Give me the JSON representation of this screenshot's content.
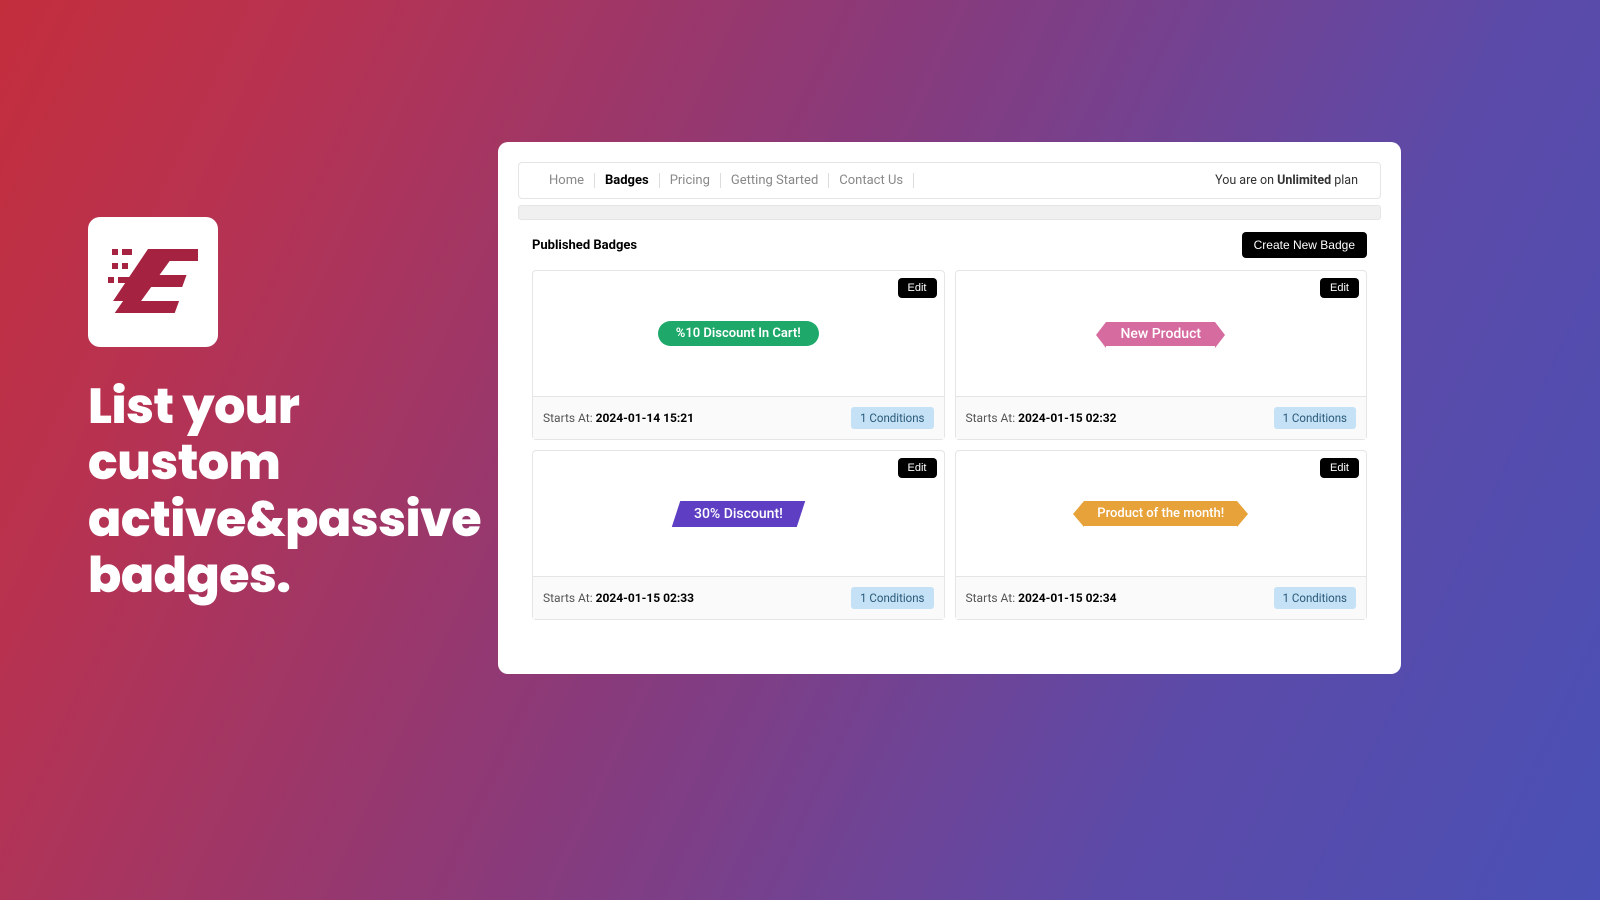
{
  "left": {
    "tagline": "List your custom active&passive badges."
  },
  "nav": {
    "items": [
      "Home",
      "Badges",
      "Pricing",
      "Getting Started",
      "Contact Us"
    ],
    "active_index": 1,
    "plan_prefix": "You are on ",
    "plan_name": "Unlimited",
    "plan_suffix": " plan"
  },
  "section": {
    "title": "Published Badges",
    "create_btn": "Create New Badge"
  },
  "edit_label": "Edit",
  "starts_at_label": "Starts At: ",
  "badges": [
    {
      "text": "%10 Discount In Cart!",
      "style": "pill",
      "color": "#1ea96a",
      "starts_at": "2024-01-14 15:21",
      "conditions": "1 Conditions"
    },
    {
      "text": "New Product",
      "style": "ribbon",
      "color": "#d66ba0",
      "starts_at": "2024-01-15 02:32",
      "conditions": "1 Conditions"
    },
    {
      "text": "30% Discount!",
      "style": "para",
      "color": "#5e3fc4",
      "starts_at": "2024-01-15 02:33",
      "conditions": "1 Conditions"
    },
    {
      "text": "Product of the month!",
      "style": "tag",
      "color": "#e8a23a",
      "starts_at": "2024-01-15 02:34",
      "conditions": "1 Conditions"
    }
  ]
}
